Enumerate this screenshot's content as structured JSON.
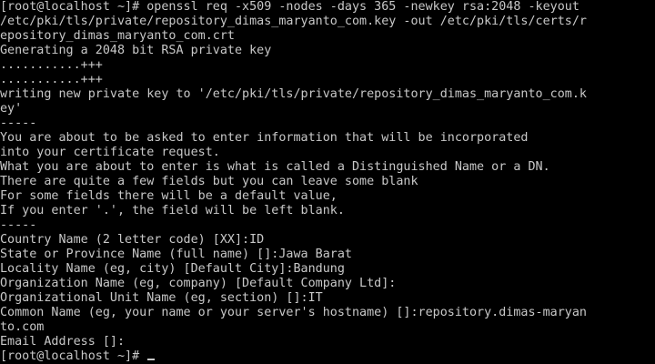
{
  "terminal": {
    "text_color": "#c8c8c8",
    "background_color": "#000000",
    "lines": [
      "[root@localhost ~]# openssl req -x509 -nodes -days 365 -newkey rsa:2048 -keyout",
      "/etc/pki/tls/private/repository_dimas_maryanto_com.key -out /etc/pki/tls/certs/r",
      "epository_dimas_maryanto_com.crt",
      "Generating a 2048 bit RSA private key",
      "...........+++",
      "...........+++",
      "writing new private key to '/etc/pki/tls/private/repository_dimas_maryanto_com.k",
      "ey'",
      "-----",
      "You are about to be asked to enter information that will be incorporated",
      "into your certificate request.",
      "What you are about to enter is what is called a Distinguished Name or a DN.",
      "There are quite a few fields but you can leave some blank",
      "For some fields there will be a default value,",
      "If you enter '.', the field will be left blank.",
      "-----",
      "Country Name (2 letter code) [XX]:ID",
      "State or Province Name (full name) []:Jawa Barat",
      "Locality Name (eg, city) [Default City]:Bandung",
      "Organization Name (eg, company) [Default Company Ltd]:",
      "Organizational Unit Name (eg, section) []:IT",
      "Common Name (eg, your name or your server's hostname) []:repository.dimas-maryan",
      "to.com",
      "Email Address []:"
    ],
    "prompt": "[root@localhost ~]# "
  }
}
